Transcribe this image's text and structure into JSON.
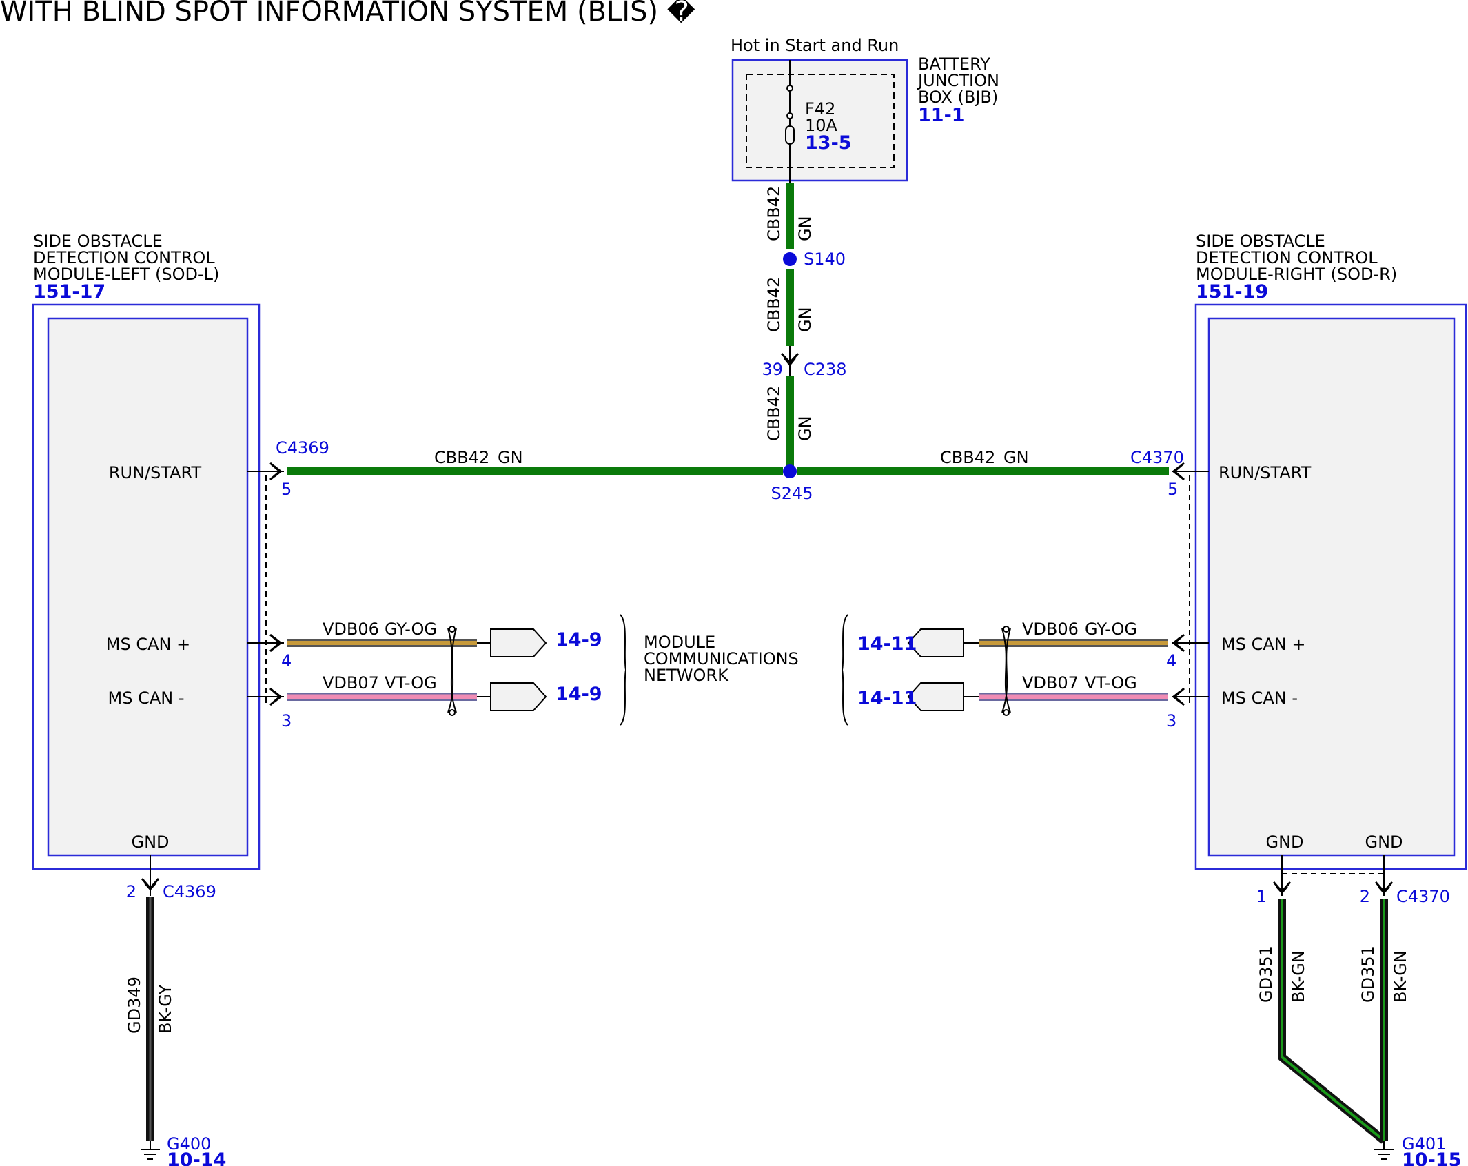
{
  "title": "WITH BLIND SPOT INFORMATION SYSTEM (BLIS) �",
  "power": {
    "label": "Hot in Start and Run",
    "box_name": [
      "BATTERY",
      "JUNCTION",
      "BOX (BJB)"
    ],
    "box_ref": "11-1",
    "fuse_id": "F42",
    "fuse_rating": "10A",
    "fuse_ref": "13-5"
  },
  "feed_wire": {
    "circuit": "CBB42",
    "color": "GN"
  },
  "splices": {
    "upper": "S140",
    "lower": "S245"
  },
  "inline_connector": {
    "id": "C238",
    "pin": "39"
  },
  "left_module": {
    "name": [
      "SIDE OBSTACLE",
      "DETECTION CONTROL",
      "MODULE-LEFT (SOD-L)"
    ],
    "ref": "151-17",
    "connector": "C4369",
    "pins": [
      {
        "label": "RUN/START",
        "pin": "5"
      },
      {
        "label": "MS CAN +",
        "pin": "4"
      },
      {
        "label": "MS CAN -",
        "pin": "3"
      },
      {
        "label": "GND",
        "pin": "2"
      }
    ]
  },
  "right_module": {
    "name": [
      "SIDE OBSTACLE",
      "DETECTION CONTROL",
      "MODULE-RIGHT (SOD-R)"
    ],
    "ref": "151-19",
    "connector": "C4370",
    "pins": [
      {
        "label": "RUN/START",
        "pin": "5"
      },
      {
        "label": "MS CAN +",
        "pin": "4"
      },
      {
        "label": "MS CAN -",
        "pin": "3"
      },
      {
        "label": "GND",
        "pin": "1"
      },
      {
        "label": "GND",
        "pin": "2"
      }
    ]
  },
  "can_wires": {
    "plus": {
      "circuit": "VDB06",
      "color": "GY-OG"
    },
    "minus": {
      "circuit": "VDB07",
      "color": "VT-OG"
    }
  },
  "network": {
    "label": [
      "MODULE",
      "COMMUNICATIONS",
      "NETWORK"
    ],
    "left_refs": [
      "14-9",
      "14-9"
    ],
    "right_refs": [
      "14-11",
      "14-11"
    ]
  },
  "grounds": {
    "left": {
      "circuit": "GD349",
      "color": "BK-GY",
      "id": "G400",
      "ref": "10-14"
    },
    "right": {
      "circuit": "GD351",
      "color": "BK-GN",
      "id": "G401",
      "ref": "10-15"
    }
  },
  "colors": {
    "wire_green": "#0a7a0a",
    "ref_blue": "#0a0ad8",
    "module_fill": "#f2f2f2",
    "wire_black": "#111111",
    "wire_pink": "#f08cb4",
    "wire_grey_orange": "#8a8a6a"
  }
}
